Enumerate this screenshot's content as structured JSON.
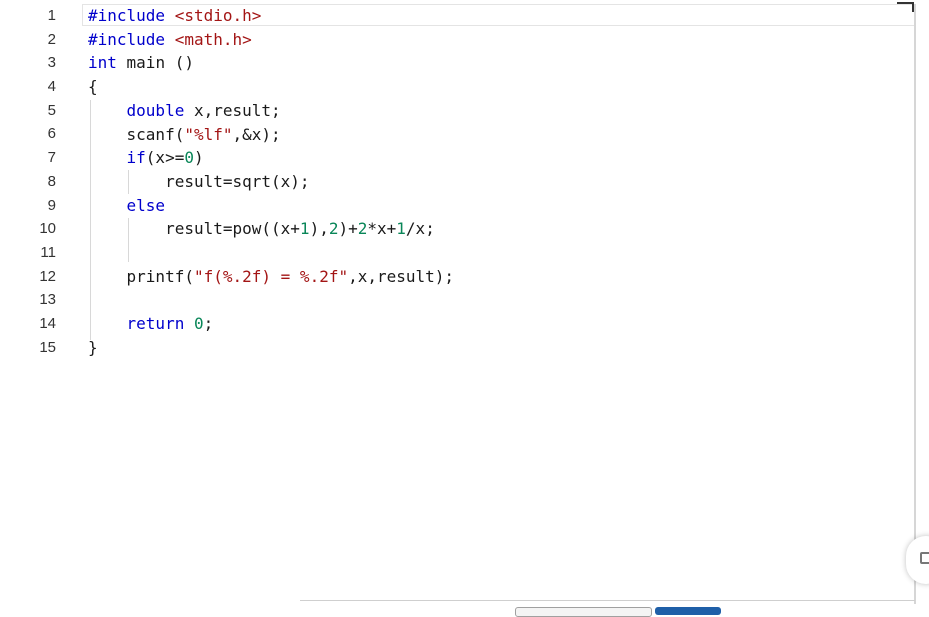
{
  "editor": {
    "line_numbers": [
      "1",
      "2",
      "3",
      "4",
      "5",
      "6",
      "7",
      "8",
      "9",
      "10",
      "11",
      "12",
      "13",
      "14",
      "15"
    ],
    "lines": [
      [
        {
          "t": "#include ",
          "c": "kw"
        },
        {
          "t": "<stdio.h>",
          "c": "str"
        }
      ],
      [
        {
          "t": "#include ",
          "c": "kw"
        },
        {
          "t": "<math.h>",
          "c": "str"
        }
      ],
      [
        {
          "t": "int",
          "c": "kw"
        },
        {
          "t": " main ()",
          "c": ""
        }
      ],
      [
        {
          "t": "{",
          "c": ""
        }
      ],
      [
        {
          "t": "    ",
          "c": ""
        },
        {
          "t": "double",
          "c": "kw"
        },
        {
          "t": " x,result;",
          "c": ""
        }
      ],
      [
        {
          "t": "    scanf(",
          "c": ""
        },
        {
          "t": "\"%lf\"",
          "c": "str"
        },
        {
          "t": ",&x);",
          "c": ""
        }
      ],
      [
        {
          "t": "    ",
          "c": ""
        },
        {
          "t": "if",
          "c": "kw"
        },
        {
          "t": "(x>=",
          "c": ""
        },
        {
          "t": "0",
          "c": "num"
        },
        {
          "t": ")",
          "c": ""
        }
      ],
      [
        {
          "t": "        result=sqrt(x);",
          "c": ""
        }
      ],
      [
        {
          "t": "    ",
          "c": ""
        },
        {
          "t": "else",
          "c": "kw"
        }
      ],
      [
        {
          "t": "        result=pow((x+",
          "c": ""
        },
        {
          "t": "1",
          "c": "num"
        },
        {
          "t": "),",
          "c": ""
        },
        {
          "t": "2",
          "c": "num"
        },
        {
          "t": ")+",
          "c": ""
        },
        {
          "t": "2",
          "c": "num"
        },
        {
          "t": "*x+",
          "c": ""
        },
        {
          "t": "1",
          "c": "num"
        },
        {
          "t": "/x;",
          "c": ""
        }
      ],
      [],
      [
        {
          "t": "    printf(",
          "c": ""
        },
        {
          "t": "\"f(%.2f) = %.2f\"",
          "c": "str"
        },
        {
          "t": ",x,result);",
          "c": ""
        }
      ],
      [],
      [
        {
          "t": "    ",
          "c": ""
        },
        {
          "t": "return",
          "c": "kw"
        },
        {
          "t": " ",
          "c": ""
        },
        {
          "t": "0",
          "c": "num"
        },
        {
          "t": ";",
          "c": ""
        }
      ],
      [
        {
          "t": "}",
          "c": ""
        }
      ]
    ]
  },
  "colors": {
    "keyword": "#0000cc",
    "string": "#a31515",
    "number": "#098658",
    "text": "#1a1a1a",
    "line_number": "#333333"
  },
  "icons": {
    "side_widget": "feedback-icon"
  }
}
